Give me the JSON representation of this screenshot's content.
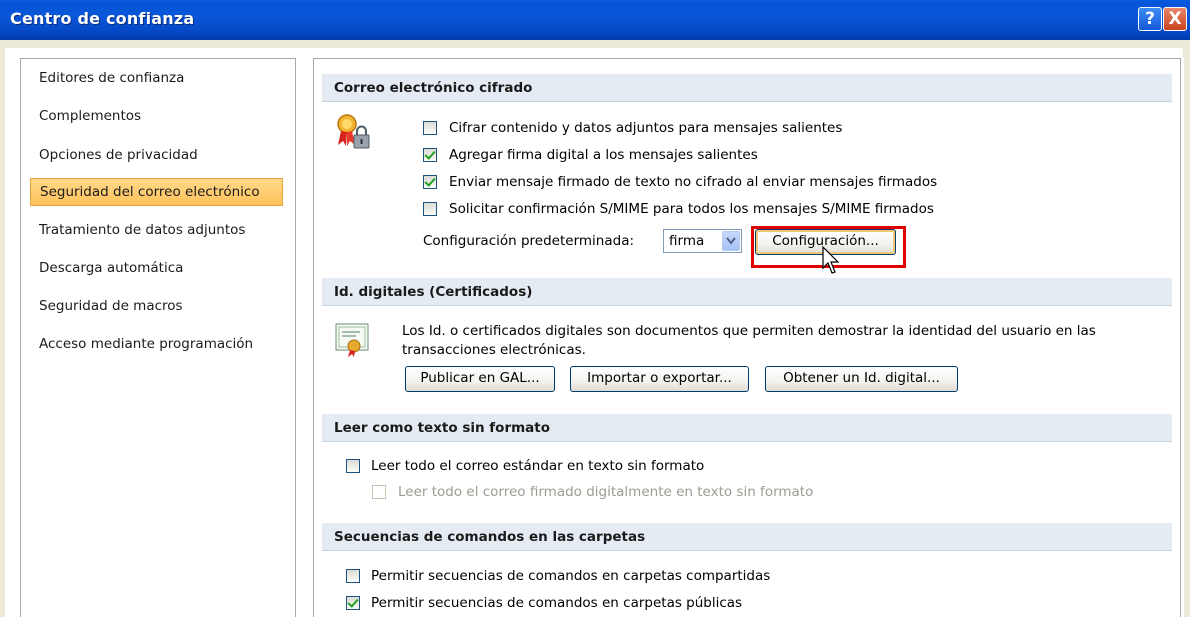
{
  "window": {
    "title": "Centro de confianza",
    "help_glyph": "?",
    "close_glyph": "X"
  },
  "nav": {
    "items": [
      {
        "label": "Editores de confianza",
        "selected": false
      },
      {
        "label": "Complementos",
        "selected": false
      },
      {
        "label": "Opciones de privacidad",
        "selected": false
      },
      {
        "label": "Seguridad del correo electrónico",
        "selected": true
      },
      {
        "label": "Tratamiento de datos adjuntos",
        "selected": false
      },
      {
        "label": "Descarga automática",
        "selected": false
      },
      {
        "label": "Seguridad de macros",
        "selected": false
      },
      {
        "label": "Acceso mediante programación",
        "selected": false
      }
    ]
  },
  "encrypted": {
    "header": "Correo electrónico cifrado",
    "icon": "certificate-lock-icon",
    "options": [
      {
        "label": "Cifrar contenido y datos adjuntos para mensajes salientes",
        "checked": false
      },
      {
        "label": "Agregar firma digital a los mensajes salientes",
        "checked": true
      },
      {
        "label": "Enviar mensaje firmado de texto no cifrado al enviar mensajes firmados",
        "checked": true
      },
      {
        "label": "Solicitar confirmación S/MIME para todos los mensajes S/MIME firmados",
        "checked": false
      }
    ],
    "default_setting_label": "Configuración predeterminada:",
    "default_setting_value": "firma",
    "settings_button": "Configuración...",
    "highlight_color": "#e00000"
  },
  "digital_ids": {
    "header": "Id. digitales (Certificados)",
    "icon": "certificate-icon",
    "description_line1": "Los Id. o certificados digitales son documentos que permiten demostrar la identidad del usuario en las",
    "description_line2": "transacciones electrónicas.",
    "buttons": [
      "Publicar en GAL...",
      "Importar o exportar...",
      "Obtener un Id. digital..."
    ]
  },
  "plain_text": {
    "header": "Leer como texto sin formato",
    "options": [
      {
        "label": "Leer todo el correo estándar en texto sin formato",
        "checked": false,
        "enabled": true
      },
      {
        "label": "Leer todo el correo firmado digitalmente en texto sin formato",
        "checked": false,
        "enabled": false
      }
    ]
  },
  "scripts": {
    "header": "Secuencias de comandos en las carpetas",
    "options": [
      {
        "label": "Permitir secuencias de comandos en carpetas compartidas",
        "checked": false
      },
      {
        "label": "Permitir secuencias de comandos en carpetas públicas",
        "checked": true
      }
    ]
  },
  "colors": {
    "titlebar": "#0554d8",
    "selection": "#ffc25a",
    "section_bg": "#e5ebf3"
  }
}
